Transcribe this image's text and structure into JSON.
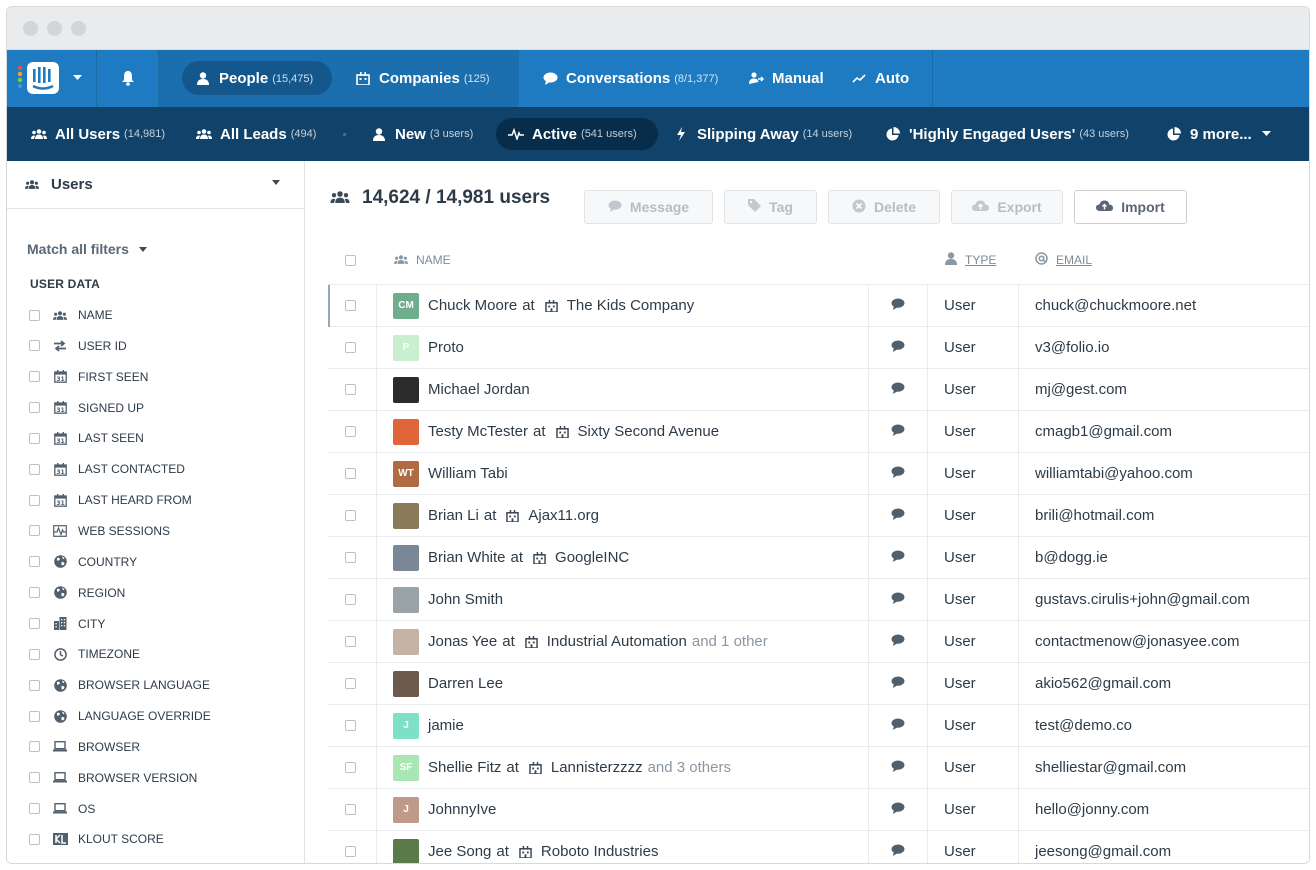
{
  "window": {
    "dots": [
      "#d3d5d8",
      "#d3d5d8",
      "#d3d5d8"
    ]
  },
  "nav_primary": {
    "items": [
      {
        "label": "People",
        "count": "(15,475)",
        "icon": "person-icon"
      },
      {
        "label": "Companies",
        "count": "(125)",
        "icon": "building-icon"
      },
      {
        "label": "Conversations",
        "count": "(8/1,377)",
        "icon": "chat-icon"
      },
      {
        "label": "Manual",
        "count": "",
        "icon": "manual-icon"
      },
      {
        "label": "Auto",
        "count": "",
        "icon": "auto-icon"
      }
    ]
  },
  "nav_segments": [
    {
      "label": "All Users",
      "count": "(14,981)",
      "icon": "group-icon"
    },
    {
      "label": "All Leads",
      "count": "(494)",
      "icon": "group-icon"
    },
    {
      "label": "New",
      "count": "(3 users)",
      "icon": "person-icon"
    },
    {
      "label": "Active",
      "count": "(541 users)",
      "icon": "pulse-icon"
    },
    {
      "label": "Slipping Away",
      "count": "(14 users)",
      "icon": "bolt-icon"
    },
    {
      "label": "'Highly Engaged Users'",
      "count": "(43 users)",
      "icon": "pie-icon"
    },
    {
      "label": "9 more...",
      "count": "",
      "icon": "pie-icon"
    }
  ],
  "sidebar": {
    "title": "Users",
    "match_label": "Match all filters",
    "section": "USER DATA",
    "filters": [
      {
        "label": "NAME",
        "icon": "group-icon"
      },
      {
        "label": "USER ID",
        "icon": "swap-icon"
      },
      {
        "label": "FIRST SEEN",
        "icon": "calendar-icon"
      },
      {
        "label": "SIGNED UP",
        "icon": "calendar-icon"
      },
      {
        "label": "LAST SEEN",
        "icon": "calendar-icon"
      },
      {
        "label": "LAST CONTACTED",
        "icon": "calendar-icon"
      },
      {
        "label": "LAST HEARD FROM",
        "icon": "calendar-icon"
      },
      {
        "label": "WEB SESSIONS",
        "icon": "pulse-icon"
      },
      {
        "label": "COUNTRY",
        "icon": "globe-icon"
      },
      {
        "label": "REGION",
        "icon": "globe-icon"
      },
      {
        "label": "CITY",
        "icon": "city-icon"
      },
      {
        "label": "TIMEZONE",
        "icon": "clock-icon"
      },
      {
        "label": "BROWSER LANGUAGE",
        "icon": "globe-icon"
      },
      {
        "label": "LANGUAGE OVERRIDE",
        "icon": "globe-icon"
      },
      {
        "label": "BROWSER",
        "icon": "laptop-icon"
      },
      {
        "label": "BROWSER VERSION",
        "icon": "laptop-icon"
      },
      {
        "label": "OS",
        "icon": "laptop-icon"
      },
      {
        "label": "KLOUT SCORE",
        "icon": "klout-icon"
      }
    ]
  },
  "main": {
    "count_label": "14,624 / 14,981 users",
    "actions": [
      {
        "label": "Message",
        "icon": "chat-icon",
        "enabled": false
      },
      {
        "label": "Tag",
        "icon": "tag-icon",
        "enabled": false
      },
      {
        "label": "Delete",
        "icon": "delete-icon",
        "enabled": false
      },
      {
        "label": "Export",
        "icon": "cloud-icon",
        "enabled": false
      },
      {
        "label": "Import",
        "icon": "cloud-icon",
        "enabled": true
      }
    ],
    "columns": {
      "name": "NAME",
      "type": "TYPE",
      "email": "EMAIL"
    },
    "rows": [
      {
        "avatar": "CM",
        "avatar_color": "#6fae8c",
        "name": "Chuck Moore",
        "company": "The Kids Company",
        "extra": "",
        "type": "User",
        "email": "chuck@chuckmoore.net"
      },
      {
        "avatar": "P",
        "avatar_color": "#c9efd0",
        "name": "Proto",
        "company": "",
        "extra": "",
        "type": "User",
        "email": "v3@folio.io"
      },
      {
        "avatar": "",
        "avatar_color": "#2b2b2b",
        "name": "Michael Jordan",
        "company": "",
        "extra": "",
        "type": "User",
        "email": "mj@gest.com"
      },
      {
        "avatar": "",
        "avatar_color": "#e0663a",
        "name": "Testy McTester",
        "company": "Sixty Second Avenue",
        "extra": "",
        "type": "User",
        "email": "cmagb1@gmail.com"
      },
      {
        "avatar": "WT",
        "avatar_color": "#b06b45",
        "name": "William Tabi",
        "company": "",
        "extra": "",
        "type": "User",
        "email": "williamtabi@yahoo.com"
      },
      {
        "avatar": "",
        "avatar_color": "#8a7a5a",
        "name": "Brian Li",
        "company": "Ajax11.org",
        "extra": "",
        "type": "User",
        "email": "brili@hotmail.com"
      },
      {
        "avatar": "",
        "avatar_color": "#7a8796",
        "name": "Brian White",
        "company": "GoogleINC",
        "extra": "",
        "type": "User",
        "email": "b@dogg.ie"
      },
      {
        "avatar": "",
        "avatar_color": "#9aa3a8",
        "name": "John Smith",
        "company": "",
        "extra": "",
        "type": "User",
        "email": "gustavs.cirulis+john@gmail.com"
      },
      {
        "avatar": "",
        "avatar_color": "#c6b3a4",
        "name": "Jonas Yee",
        "company": "Industrial Automation",
        "extra": "and 1 other",
        "type": "User",
        "email": "contactmenow@jonasyee.com"
      },
      {
        "avatar": "",
        "avatar_color": "#6e5a4c",
        "name": "Darren Lee",
        "company": "",
        "extra": "",
        "type": "User",
        "email": "akio562@gmail.com"
      },
      {
        "avatar": "J",
        "avatar_color": "#7fe0c8",
        "name": "jamie",
        "company": "",
        "extra": "",
        "type": "User",
        "email": "test@demo.co"
      },
      {
        "avatar": "SF",
        "avatar_color": "#a8e6b4",
        "name": "Shellie Fitz",
        "company": "Lannisterzzzz",
        "extra": "and 3 others",
        "type": "User",
        "email": "shelliestar@gmail.com"
      },
      {
        "avatar": "J",
        "avatar_color": "#c09a88",
        "name": "JohnnyIve",
        "company": "",
        "extra": "",
        "type": "User",
        "email": "hello@jonny.com"
      },
      {
        "avatar": "",
        "avatar_color": "#5b7a4a",
        "name": "Jee Song",
        "company": "Roboto Industries",
        "extra": "",
        "type": "User",
        "email": "jeesong@gmail.com"
      }
    ]
  }
}
